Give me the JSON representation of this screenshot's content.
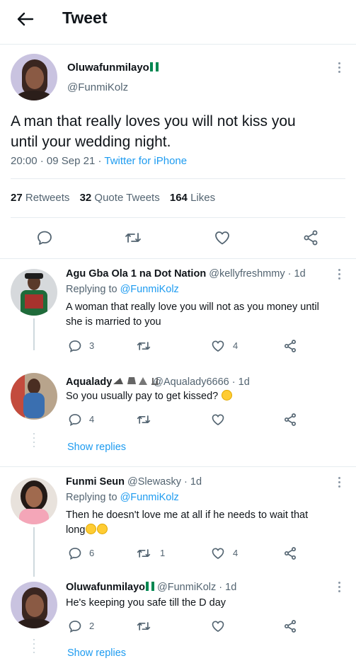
{
  "header": {
    "title": "Tweet"
  },
  "tweet": {
    "author_name": "Oluwafunmilayo",
    "author_handle": "@FunmiKolz",
    "text_line1": "A man that really loves you will not kiss you",
    "text_line2": "until your wedding night.",
    "time": "20:00",
    "date": "09 Sep 21",
    "source": "Twitter for iPhone",
    "retweets_count": "27",
    "retweets_label": "Retweets",
    "quotes_count": "32",
    "quotes_label": "Quote Tweets",
    "likes_count": "164",
    "likes_label": "Likes"
  },
  "replies": [
    {
      "name": "Agu Gba Ola 1 na Dot Nation",
      "handle": "@kellyfreshmmy",
      "time": "1d",
      "replying_prefix": "Replying to",
      "replying_to": "@FunmiKolz",
      "text_line1": "A woman that really love you will not as you money until",
      "text_line2": "she is married to you",
      "replies": "3",
      "retweets": "",
      "likes": "4"
    },
    {
      "name": "Aqualady",
      "handle": "@Aqualady6666",
      "time": "1d",
      "text_line1": "So you usually pay to get kissed?",
      "replies": "4",
      "retweets": "",
      "likes": "",
      "show_replies": "Show replies"
    },
    {
      "name": "Funmi Seun",
      "handle": "@Slewasky",
      "time": "1d",
      "replying_prefix": "Replying to",
      "replying_to": "@FunmiKolz",
      "text_line1": "Then he doesn't love me at all if he needs to wait that",
      "text_line2": "long",
      "replies": "6",
      "retweets": "1",
      "likes": "4"
    },
    {
      "name": "Oluwafunmilayo",
      "handle": "@FunmiKolz",
      "time": "1d",
      "text_line1": "He's keeping you safe till the D day",
      "replies": "2",
      "retweets": "",
      "likes": "",
      "show_replies": "Show replies"
    }
  ],
  "separator": "·",
  "colors": {
    "accent": "#1d9bf0",
    "text": "#0f1419",
    "muted": "#536471",
    "flag_green": "#008751"
  },
  "icons": [
    "back-arrow-icon",
    "more-icon",
    "reply-icon",
    "retweet-icon",
    "like-icon",
    "share-icon",
    "nigeria-flag-icon",
    "laughing-emoji-icon"
  ]
}
